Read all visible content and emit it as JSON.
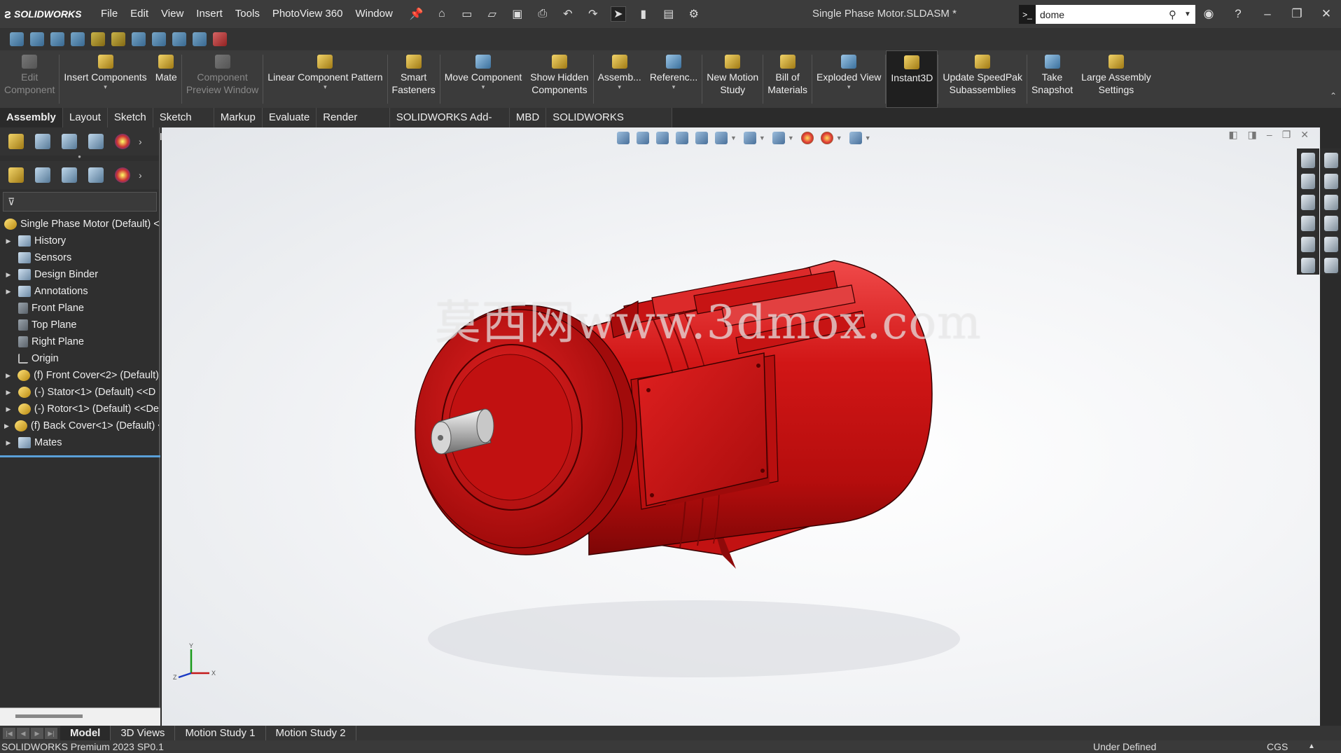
{
  "app": {
    "brand": "SOLIDWORKS",
    "document_title": "Single Phase Motor.SLDASM *"
  },
  "menu": [
    "File",
    "Edit",
    "View",
    "Insert",
    "Tools",
    "PhotoView 360",
    "Window"
  ],
  "search": {
    "value": "dome"
  },
  "ribbon": [
    {
      "label": "Edit\nComponent",
      "icon": "edit-component-icon",
      "disabled": true,
      "caret": false
    },
    {
      "label": "Insert Components",
      "icon": "insert-components-icon",
      "disabled": false,
      "caret": true
    },
    {
      "label": "Mate",
      "icon": "mate-icon",
      "disabled": false,
      "caret": false
    },
    {
      "label": "Component\nPreview Window",
      "icon": "component-preview-icon",
      "disabled": true,
      "caret": false
    },
    {
      "label": "Linear Component Pattern",
      "icon": "linear-pattern-icon",
      "disabled": false,
      "caret": true
    },
    {
      "label": "Smart\nFasteners",
      "icon": "smart-fasteners-icon",
      "disabled": false,
      "caret": false
    },
    {
      "label": "Move Component",
      "icon": "move-component-icon",
      "disabled": false,
      "caret": true
    },
    {
      "label": "Show Hidden\nComponents",
      "icon": "show-hidden-icon",
      "disabled": false,
      "caret": false
    },
    {
      "label": "Assemb...",
      "icon": "assembly-features-icon",
      "disabled": false,
      "caret": true
    },
    {
      "label": "Referenc...",
      "icon": "reference-geometry-icon",
      "disabled": false,
      "caret": true
    },
    {
      "label": "New Motion\nStudy",
      "icon": "motion-study-icon",
      "disabled": false,
      "caret": false
    },
    {
      "label": "Bill of\nMaterials",
      "icon": "bom-icon",
      "disabled": false,
      "caret": false
    },
    {
      "label": "Exploded View",
      "icon": "exploded-view-icon",
      "disabled": false,
      "caret": true
    },
    {
      "label": "Instant3D",
      "icon": "instant3d-icon",
      "disabled": false,
      "caret": false,
      "active": true
    },
    {
      "label": "Update SpeedPak\nSubassemblies",
      "icon": "speedpak-icon",
      "disabled": false,
      "caret": false
    },
    {
      "label": "Take\nSnapshot",
      "icon": "snapshot-icon",
      "disabled": false,
      "caret": false
    },
    {
      "label": "Large Assembly\nSettings",
      "icon": "large-assembly-icon",
      "disabled": false,
      "caret": false
    }
  ],
  "tabs": [
    "Assembly",
    "Layout",
    "Sketch",
    "Sketch Ink",
    "Markup",
    "Evaluate",
    "Render Tools",
    "SOLIDWORKS Add-Ins",
    "MBD",
    "SOLIDWORKS Visualize"
  ],
  "active_tab": "Assembly",
  "tree": {
    "root": "Single Phase Motor (Default) <",
    "items": [
      {
        "label": "History",
        "expand": true,
        "icon": "history"
      },
      {
        "label": "Sensors",
        "expand": false,
        "icon": "sensors"
      },
      {
        "label": "Design Binder",
        "expand": true,
        "icon": "binder"
      },
      {
        "label": "Annotations",
        "expand": true,
        "icon": "annotations"
      },
      {
        "label": "Front Plane",
        "expand": false,
        "icon": "plane"
      },
      {
        "label": "Top Plane",
        "expand": false,
        "icon": "plane"
      },
      {
        "label": "Right Plane",
        "expand": false,
        "icon": "plane"
      },
      {
        "label": "Origin",
        "expand": false,
        "icon": "origin"
      },
      {
        "label": "(f) Front Cover<2> (Default)",
        "expand": true,
        "icon": "part"
      },
      {
        "label": "(-) Stator<1> (Default) <<D",
        "expand": true,
        "icon": "part"
      },
      {
        "label": "(-) Rotor<1> (Default) <<De",
        "expand": true,
        "icon": "part"
      },
      {
        "label": "(f) Back Cover<1> (Default) <",
        "expand": true,
        "icon": "part"
      },
      {
        "label": "Mates",
        "expand": true,
        "icon": "mates"
      }
    ]
  },
  "watermark": "莫西网www.3dmox.com",
  "triad": {
    "x": "X",
    "y": "Y",
    "z": "Z"
  },
  "bottom_tabs": [
    "Model",
    "3D Views",
    "Motion Study 1",
    "Motion Study 2"
  ],
  "active_bottom_tab": "Model",
  "status": {
    "product": "SOLIDWORKS Premium 2023 SP0.1",
    "state": "Under Defined",
    "units": "CGS"
  },
  "colors": {
    "motor": "#d11616",
    "ui_dark": "#2f2f2f",
    "accent": "#5aa0d8"
  }
}
